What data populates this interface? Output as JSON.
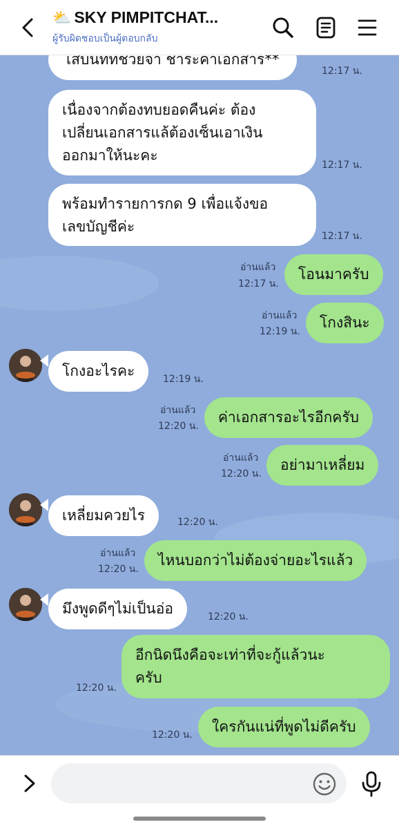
{
  "header": {
    "weather_emoji": "⛅",
    "title": "SKY PIMPITCHAT...",
    "subtitle": "ผู้รับผิดชอบเป็นผู้ตอบกลับ"
  },
  "messages": [
    {
      "side": "in",
      "text": "เสบนททชวยจา ชาระคาเอกสาร**",
      "time": "12:17 น."
    },
    {
      "side": "in",
      "lines": [
        "เนื่องจากต้องทบยอดคืนค่ะ  ต้อง",
        "เปลี่ยนเอกสารแล้ต้องเซ็นเอาเงิน",
        "ออกมาให้นะคะ"
      ],
      "time": "12:17 น."
    },
    {
      "side": "in",
      "lines": [
        "พร้อมทำรายการกด 9 เพื่อแจ้งขอ",
        "เลขบัญชีค่ะ"
      ],
      "time": "12:17 น."
    },
    {
      "side": "out",
      "text": "โอนมาครับ",
      "read": "อ่านแล้ว",
      "time": "12:17 น."
    },
    {
      "side": "out",
      "text": "โกงสินะ",
      "read": "อ่านแล้ว",
      "time": "12:19 น."
    },
    {
      "side": "in",
      "text": "โกงอะไรคะ",
      "time": "12:19 น."
    },
    {
      "side": "out",
      "text": "ค่าเอกสารอะไรอีกครับ",
      "read": "อ่านแล้ว",
      "time": "12:20 น."
    },
    {
      "side": "out",
      "text": "อย่ามาเหลี่ยม",
      "read": "อ่านแล้ว",
      "time": "12:20 น."
    },
    {
      "side": "in",
      "text": "เหลี่ยมควยไร",
      "time": "12:20 น."
    },
    {
      "side": "out",
      "text": "ไหนบอกว่าไม่ต้องจ่ายอะไรแล้ว",
      "read": "อ่านแล้ว",
      "time": "12:20 น."
    },
    {
      "side": "in",
      "text": "มึงพูดดีๆไม่เป็นอ่อ",
      "time": "12:20 น."
    },
    {
      "side": "out",
      "lines": [
        "อีกนิดนึงคือจะเท่าที่จะกู้แล้วนะ",
        "ครับ"
      ],
      "time": "12:20 น."
    },
    {
      "side": "out",
      "text": "ใครกันแน่ที่พูดไม่ดีครับ",
      "time": "12:20 น."
    }
  ],
  "input": {
    "placeholder": ""
  },
  "colors": {
    "chat_background": "#8facdc",
    "incoming_bubble": "#ffffff",
    "outgoing_bubble": "#a3e48d",
    "subtitle_link": "#4c6fc4"
  },
  "icons": [
    "back-arrow-icon",
    "search-icon",
    "notes-icon",
    "menu-icon",
    "chevron-right-icon",
    "emoji-icon",
    "microphone-icon"
  ]
}
